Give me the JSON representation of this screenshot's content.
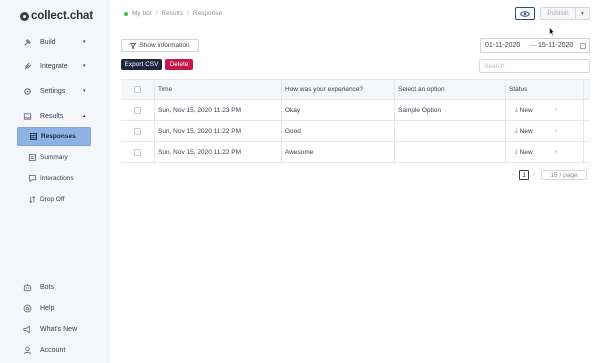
{
  "app": {
    "logo_text": "collect.chat"
  },
  "sidebar": {
    "top_items": [
      {
        "label": "Build",
        "icon": "hammer-icon",
        "chevron": "▾"
      },
      {
        "label": "Integrate",
        "icon": "plug-icon",
        "chevron": "▾"
      },
      {
        "label": "Settings",
        "icon": "gear-icon",
        "chevron": "▾"
      },
      {
        "label": "Results",
        "icon": "inbox-icon",
        "chevron": "▴"
      }
    ],
    "results_sub": [
      {
        "label": "Responses",
        "icon": "table-icon",
        "active": true
      },
      {
        "label": "Summary",
        "icon": "summary-icon",
        "active": false
      },
      {
        "label": "Interactions",
        "icon": "chat-icon",
        "active": false
      },
      {
        "label": "Drop Off",
        "icon": "dropoff-icon",
        "active": false
      }
    ],
    "bottom_items": [
      {
        "label": "Bots",
        "icon": "bot-icon"
      },
      {
        "label": "Help",
        "icon": "help-icon"
      },
      {
        "label": "What's New",
        "icon": "megaphone-icon"
      },
      {
        "label": "Account",
        "icon": "user-icon"
      }
    ]
  },
  "breadcrumb": {
    "bot": "My bot",
    "section": "Results",
    "page": "Response"
  },
  "toolbar": {
    "publish_label": "Publish",
    "show_info_label": "Show information",
    "export_label": "Export CSV",
    "delete_label": "Delete"
  },
  "date_range": {
    "start": "01-11-2020",
    "separator": "—",
    "end": "15-11-2020"
  },
  "search": {
    "placeholder": "Search"
  },
  "table": {
    "headers": [
      "Time",
      "How was your experience?",
      "Select an option",
      "Status"
    ],
    "rows": [
      {
        "time": "Sun, Nov 15, 2020 11:23 PM",
        "experience": "Okay",
        "option": "Sample Option",
        "status": "New"
      },
      {
        "time": "Sun, Nov 15, 2020 11:22 PM",
        "experience": "Good",
        "option": "",
        "status": "New"
      },
      {
        "time": "Sun, Nov 15, 2020 11:22 PM",
        "experience": "Awesome",
        "option": "",
        "status": "New"
      }
    ]
  },
  "pagination": {
    "prev": "‹",
    "current_page": "1",
    "next": "›",
    "page_size": "15 / page"
  },
  "colors": {
    "accent": "#8eb2e4",
    "export": "#1d2840",
    "delete": "#c4174a",
    "online_dot": "#3fbf5a"
  }
}
